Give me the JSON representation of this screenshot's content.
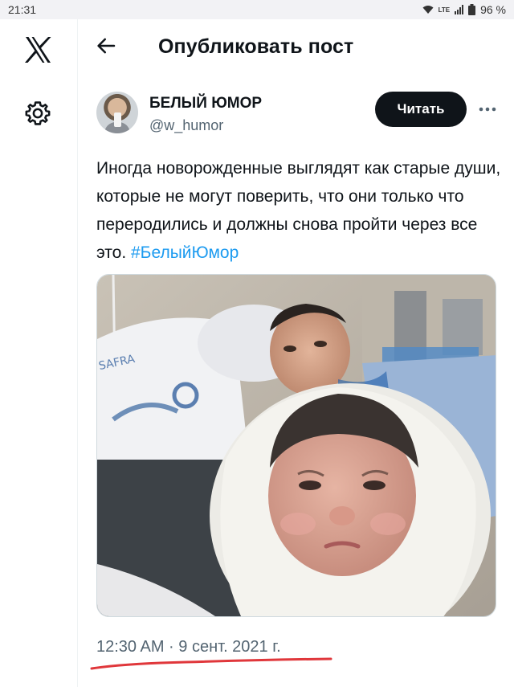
{
  "status_bar": {
    "time": "21:31",
    "network": "LTE",
    "battery": "96 %"
  },
  "header": {
    "title": "Опубликовать пост"
  },
  "post": {
    "author_name": "БЕЛЫЙ ЮМОР",
    "author_handle": "@w_humor",
    "follow_label": "Читать",
    "text": "Иногда новорожденные выглядят как старые души, которые не могут поверить, что они только что переродились и должны снова пройти через все это.",
    "hashtag": "#БелыйЮмор",
    "photo_label": "SAFRA",
    "timestamp": "12:30 AM · 9 сент. 2021 г."
  },
  "colors": {
    "accent": "#1d9bf0",
    "text": "#0f1419",
    "muted": "#536471",
    "annotation_underline": "#e0373b"
  },
  "icons": [
    "x-logo-icon",
    "gear-icon",
    "back-arrow-icon",
    "more-icon",
    "wifi-icon",
    "signal-icon"
  ]
}
